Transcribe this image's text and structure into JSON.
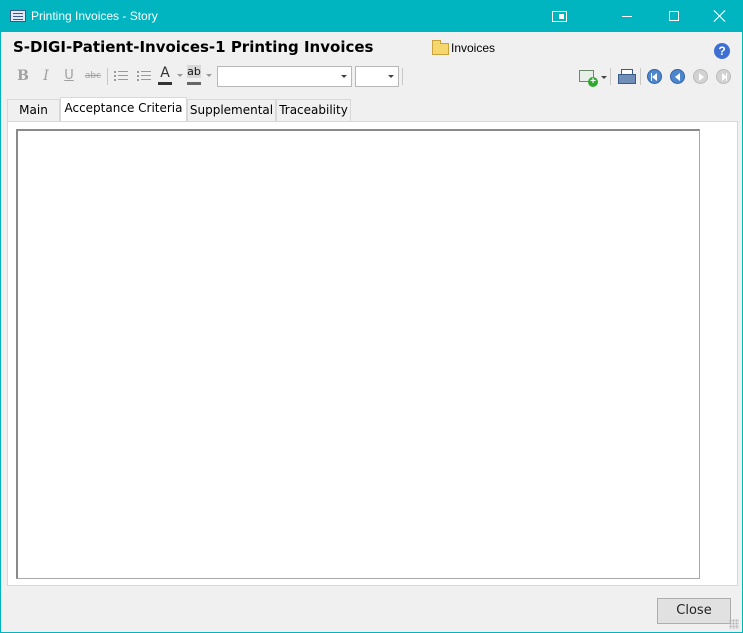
{
  "window": {
    "title": "Printing Invoices - Story",
    "accent_color": "#00b4c0"
  },
  "header": {
    "story_title": "S-DIGI-Patient-Invoices-1 Printing Invoices",
    "folder_label": "Invoices",
    "help_glyph": "?"
  },
  "toolbar": {
    "bold_glyph": "B",
    "italic_glyph": "I",
    "underline_glyph": "U",
    "strike_glyph": "abc",
    "font_color_glyph": "A",
    "highlight_glyph": "ab",
    "font_family_value": "",
    "font_size_value": ""
  },
  "tabs": [
    {
      "label": "Main"
    },
    {
      "label": "Acceptance Criteria",
      "active": true
    },
    {
      "label": "Supplemental"
    },
    {
      "label": "Traceability"
    }
  ],
  "editor": {
    "content": ""
  },
  "footer": {
    "close_label": "Close"
  }
}
